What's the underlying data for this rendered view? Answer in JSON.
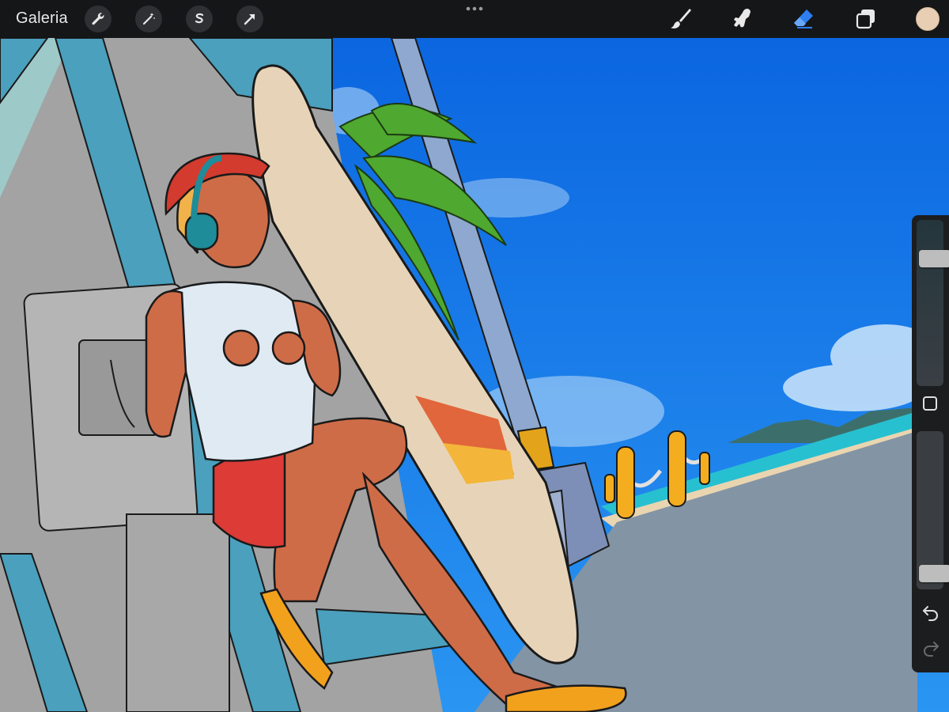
{
  "top_bar": {
    "gallery_label": "Galeria",
    "left_tools": [
      "wrench-icon",
      "magic-wand-icon",
      "selection-s-icon",
      "transform-arrow-icon"
    ],
    "right_tools": [
      "brush-icon",
      "smudge-icon",
      "eraser-icon",
      "layers-icon"
    ],
    "active_tool": "eraser-icon",
    "active_color": "#E8CFB3"
  },
  "sidebar": {
    "brush_size_level": 0.8,
    "brush_opacity_level": 0.05,
    "controls": [
      "modify-square-icon",
      "undo-icon",
      "redo-icon"
    ]
  },
  "colors": {
    "toolbar_bg": "#151617",
    "accent_blue": "#2D7FF0",
    "sky": "#1275E6"
  }
}
